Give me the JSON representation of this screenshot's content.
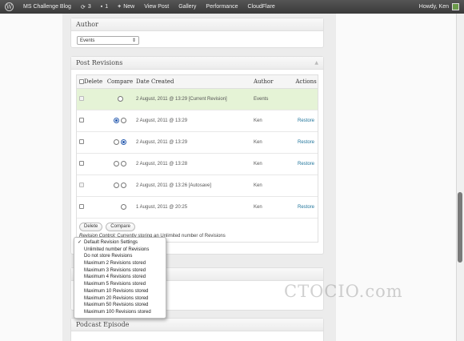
{
  "adminbar": {
    "site_name": "MS Challenge Blog",
    "updates_count": "3",
    "comments_count": "1",
    "new_label": "New",
    "view_post": "View Post",
    "gallery": "Gallery",
    "performance": "Performance",
    "cloudflare": "CloudFlare",
    "howdy": "Howdy, Ken"
  },
  "author_box": {
    "title": "Author",
    "selected": "Events"
  },
  "revisions_box": {
    "title": "Post Revisions",
    "columns": {
      "delete": "Delete",
      "compare": "Compare",
      "date": "Date Created",
      "author": "Author",
      "actions": "Actions"
    },
    "rows": [
      {
        "date": "2 August, 2011 @ 13:29 [Current Revision]",
        "author": "Events",
        "action": ""
      },
      {
        "date": "2 August, 2011 @ 13:29",
        "author": "Ken",
        "action": "Restore"
      },
      {
        "date": "2 August, 2011 @ 13:29",
        "author": "Ken",
        "action": "Restore"
      },
      {
        "date": "2 August, 2011 @ 13:28",
        "author": "Ken",
        "action": "Restore"
      },
      {
        "date": "2 August, 2011 @ 13:26 [Autosave]",
        "author": "Ken",
        "action": ""
      },
      {
        "date": "1 August, 2011 @ 20:25",
        "author": "Ken",
        "action": "Restore"
      }
    ],
    "delete_button": "Delete",
    "compare_button": "Compare",
    "control_label": "Revision Control:",
    "control_text": " Currently storing an Unlimited number of Revisions"
  },
  "revision_menu": {
    "checkmark": "✓",
    "options": [
      "Default Revision Settings",
      "Unlimited number of Revisions",
      "Do not store Revisions",
      "Maximum 2 Revisions stored",
      "Maximum 3 Revisions stored",
      "Maximum 4 Revisions stored",
      "Maximum 5 Revisions stored",
      "Maximum 10 Revisions stored",
      "Maximum 20 Revisions stored",
      "Maximum 50 Revisions stored",
      "Maximum 100 Revisions stored"
    ]
  },
  "podcast_box": {
    "title": "Podcast Episode"
  },
  "watermark": "CTOCIO.com",
  "colors": {
    "current_row": "#e5f3d6",
    "link": "#21759b",
    "adminbar": "#464646"
  }
}
